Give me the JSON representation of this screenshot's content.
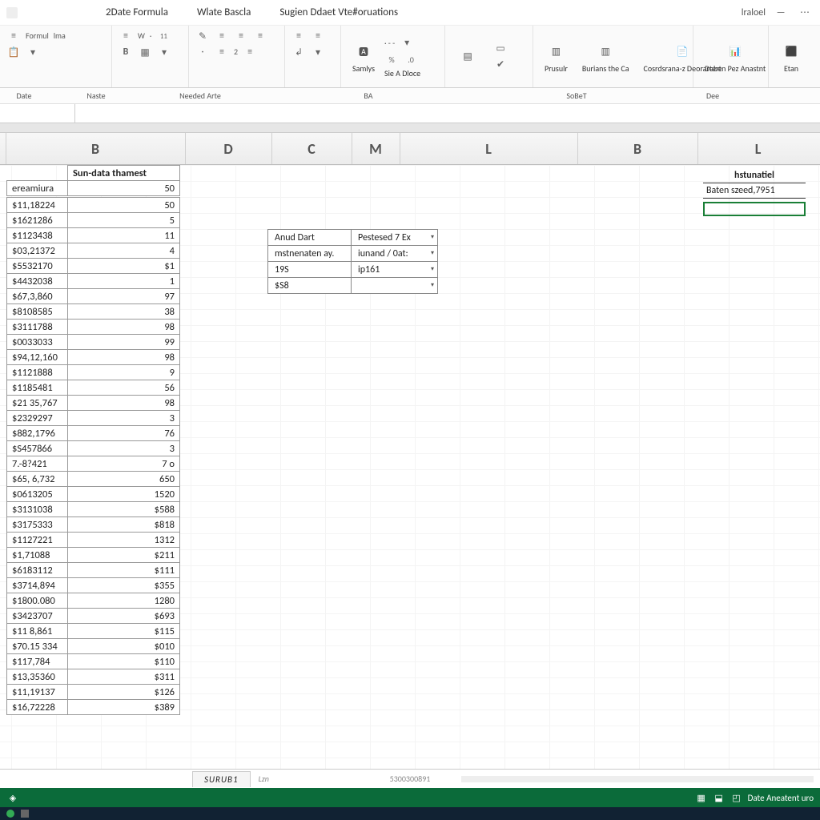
{
  "titlebar": {
    "tabs": [
      "2Date Formula",
      "Wlate Bascla",
      "Sugien Ddaet Vte#oruations"
    ],
    "right_label": "lraloel"
  },
  "ribbon": {
    "group1_top": [
      "Formul",
      "lma"
    ],
    "font_sample": "W",
    "alignment_number": "2",
    "styles_label": "Samlys",
    "styles_sub": "Sie A Dloce",
    "cells": [
      {
        "label": "Prusulr"
      },
      {
        "label": "Burians the Ca"
      },
      {
        "label": "Cosrdsrana-z Deorartert"
      }
    ],
    "analysis": {
      "label": "Daben Pez Anastnt"
    },
    "far_right": "Etan"
  },
  "subbar": {
    "items": [
      "Date",
      "Naste",
      "Needed Arte",
      "BA",
      "SoBeT",
      "Dee"
    ]
  },
  "col_headers": [
    "B",
    "D",
    "C",
    "M",
    "L",
    "B",
    "L"
  ],
  "main_table": {
    "header_a": "ereamiura",
    "header_b": "Sun-data thamest",
    "rows": [
      {
        "a": "$11,18224",
        "b": "50"
      },
      {
        "a": "$1621286",
        "b": "5"
      },
      {
        "a": "$1123438",
        "b": "11"
      },
      {
        "a": "$03,21372",
        "b": "4"
      },
      {
        "a": "$5532170",
        "b": "$1"
      },
      {
        "a": "$4432038",
        "b": "1"
      },
      {
        "a": "$67,3,860",
        "b": "97"
      },
      {
        "a": "$8108585",
        "b": "38"
      },
      {
        "a": "$3111788",
        "b": "98"
      },
      {
        "a": "$0033033",
        "b": "99"
      },
      {
        "a": "$94,12,160",
        "b": "98"
      },
      {
        "a": "$1121888",
        "b": "9"
      },
      {
        "a": "$1185481",
        "b": "56"
      },
      {
        "a": "$21 35,767",
        "b": "98"
      },
      {
        "a": "$2329297",
        "b": "3"
      },
      {
        "a": "$882,1796",
        "b": "76"
      },
      {
        "a": "$S457866",
        "b": "3"
      },
      {
        "a": "7.-8?421",
        "b": "7 o"
      },
      {
        "a": "$65, 6,732",
        "b": "650"
      },
      {
        "a": "$0613205",
        "b": "1520"
      },
      {
        "a": "$3131038",
        "b": "$588"
      },
      {
        "a": "$3175333",
        "b": "$818"
      },
      {
        "a": "$1127221",
        "b": "1312"
      },
      {
        "a": "$1,71088",
        "b": "$211"
      },
      {
        "a": "$6183112",
        "b": "$111"
      },
      {
        "a": "$3714,894",
        "b": "$355"
      },
      {
        "a": "$1800.080",
        "b": "1280"
      },
      {
        "a": "$3423707",
        "b": "$693"
      },
      {
        "a": "$11 8,861",
        "b": "$115"
      },
      {
        "a": "$70.15 334",
        "b": "$010"
      },
      {
        "a": "$117,784",
        "b": "$110"
      },
      {
        "a": "$13,35360",
        "b": "$311"
      },
      {
        "a": "$11,19137",
        "b": "$126"
      },
      {
        "a": "$16,72228",
        "b": "$389"
      }
    ]
  },
  "side_table": {
    "rows": [
      {
        "c1": "Anud Dart",
        "c2": "Pestesed 7 Ex"
      },
      {
        "c1": "mstnenaten ay.",
        "c2": "iunand / 0at:"
      },
      {
        "c1": "19S",
        "c2": "ip161"
      },
      {
        "c1": "$S8",
        "c2": ""
      }
    ]
  },
  "right_block": {
    "header": "hstunatiel",
    "value": "Baten szeed,7951"
  },
  "sheet_tabs": {
    "active": "SURUB1",
    "second": "Lzn",
    "center_num": "5300300891"
  },
  "statusbar": {
    "right_text": "Date Aneatent uro"
  }
}
